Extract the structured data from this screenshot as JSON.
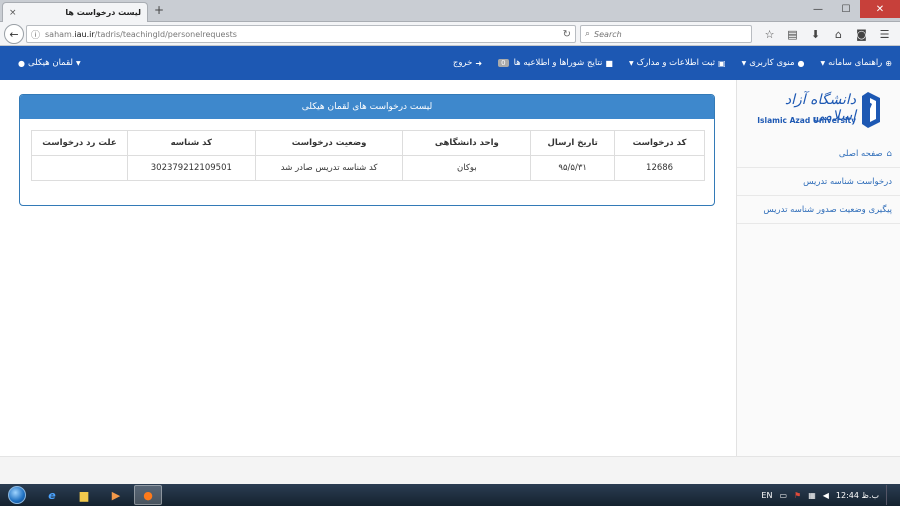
{
  "browser": {
    "tab_title": "لیست درخواست ها",
    "tab_close": "×",
    "new_tab": "+",
    "url_prefix": "saham.",
    "url_domain": "iau.ir",
    "url_path": "/tadris/teachingId/personelrequests",
    "search_placeholder": "Search",
    "window_minimize": "—",
    "window_maximize": "☐",
    "window_close": "✕"
  },
  "header": {
    "menu": [
      {
        "label": "راهنمای سامانه",
        "icon": "globe-icon",
        "has_caret": true
      },
      {
        "label": "منوی کاربری",
        "icon": "user-icon",
        "has_caret": true
      },
      {
        "label": "ثبت اطلاعات و مدارک",
        "icon": "save-icon",
        "has_caret": true
      },
      {
        "label": "نتایج شوراها و اطلاعیه ها",
        "icon": "folder-icon",
        "badge": "0"
      },
      {
        "label": "خروج",
        "icon": "logout-icon"
      }
    ],
    "user_name": "لقمان هیکلی"
  },
  "sidebar": {
    "logo_text_fa": "دانشگاه آزاد اسلامی",
    "logo_text_en": "Islamic Azad University",
    "links": [
      {
        "label": "صفحه اصلی",
        "icon": "home-icon"
      },
      {
        "label": "درخواست شناسه تدریس"
      },
      {
        "label": "پیگیری وضعیت صدور شناسه تدریس"
      }
    ]
  },
  "panel": {
    "title": "لیست درخواست های لقمان هیکلی",
    "columns": [
      "کد درخواست",
      "تاریخ ارسال",
      "واحد دانشگاهی",
      "وضعیت درخواست",
      "کد شناسه",
      "علت رد درخواست"
    ],
    "rows": [
      [
        "12686",
        "۹۵/۵/۳۱",
        "بوکان",
        "کد شناسه تدریس صادر شد",
        "302379212109501",
        ""
      ]
    ]
  },
  "taskbar": {
    "language": "EN",
    "clock": "ب.ظ 12:44"
  }
}
